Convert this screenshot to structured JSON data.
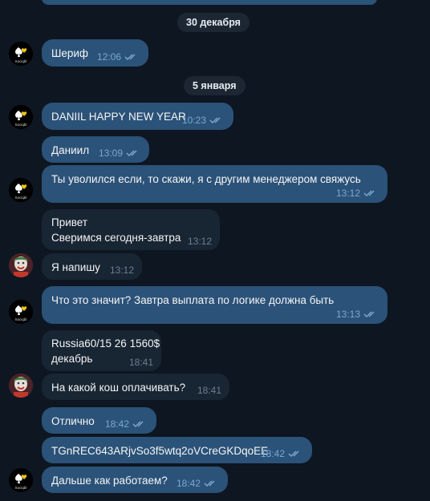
{
  "chat": {
    "logo_text": "Sociqbl",
    "dates": [
      "30 декабря",
      "5 января"
    ],
    "messages": [
      {
        "text": "Шериф",
        "time": "12:06"
      },
      {
        "text": "DANIIL HAPPY NEW YEAR",
        "time": "10:23"
      },
      {
        "text": "Даниил",
        "time": "13:09"
      },
      {
        "text": "Ты уволился если, то скажи, я с другим менеджером свяжусь",
        "time": "13:12"
      },
      {
        "text": "Привет\nСверимся сегодня-завтра",
        "time": "13:12"
      },
      {
        "text": "Я напишу",
        "time": "13:12"
      },
      {
        "text": "Что это значит? Завтра выплата по логике должна быть",
        "time": "13:13"
      },
      {
        "text": "Russia60/15 26 1560$\nдекабрь",
        "time": "18:41"
      },
      {
        "text": "На какой кош оплачивать?",
        "time": "18:41"
      },
      {
        "text": "Отлично",
        "time": "18:42"
      },
      {
        "text": "TGnREC643ARjvSo3f5wtq2oVCreGKDqoEE",
        "time": "18:42"
      },
      {
        "text": "Дальше как работаем?",
        "time": "18:42"
      }
    ]
  },
  "colors": {
    "background": "#0e1621",
    "outgoing_bubble": "#2b5278",
    "incoming_bubble": "#182533",
    "date_pill": "#1c2733",
    "outgoing_meta": "#7da8d3",
    "incoming_meta": "#6d7f8f"
  },
  "icons": {
    "read_status": "double-check-icon",
    "own_avatar": "logo-avatar",
    "contact_avatar": "joker-avatar"
  }
}
